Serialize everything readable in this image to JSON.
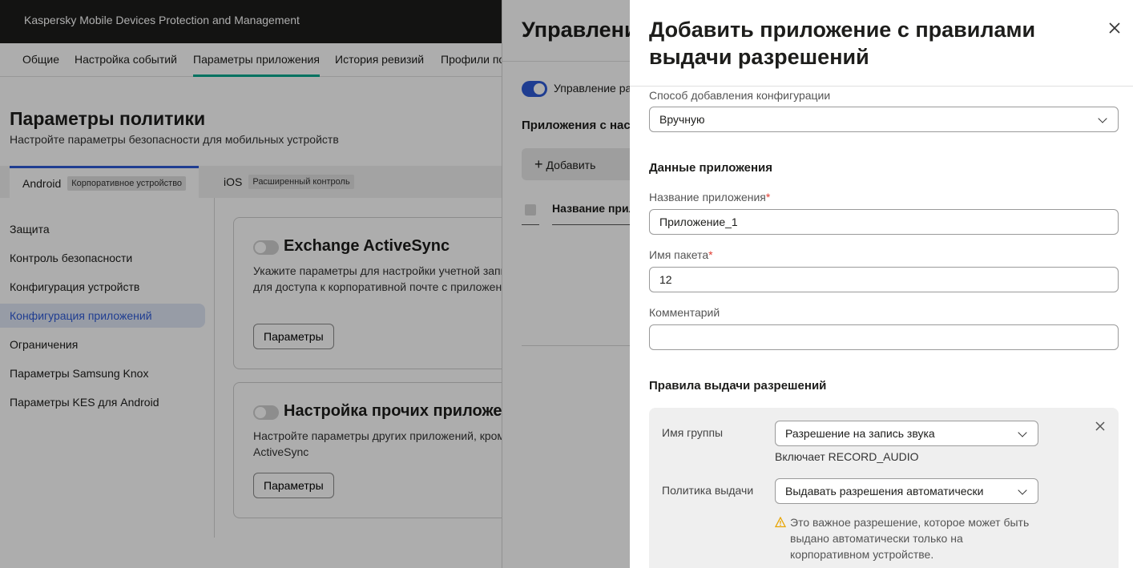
{
  "app": {
    "brand": "Kaspersky Mobile Devices Protection and Management"
  },
  "subnav": {
    "tabs": [
      "Общие",
      "Настройка событий",
      "Параметры приложения",
      "История ревизий",
      "Профили по"
    ]
  },
  "page": {
    "title": "Параметры политики",
    "subtitle": "Настройте параметры безопасности для мобильных устройств"
  },
  "os_tabs": [
    {
      "label": "Android",
      "badge": "Корпоративное устройство"
    },
    {
      "label": "iOS",
      "badge": "Расширенный контроль"
    }
  ],
  "sidebar": {
    "items": [
      "Защита",
      "Контроль безопасности",
      "Конфигурация устройств",
      "Конфигурация приложений",
      "Ограничения",
      "Параметры Samsung Knox",
      "Параметры KES для Android"
    ]
  },
  "cards": [
    {
      "title": "Exchange ActiveSync",
      "desc": "Укажите параметры для настройки учетной запи ActiveSync для доступа к корпоративной почте с приложения Gmail",
      "button": "Параметры"
    },
    {
      "title": "Настройка прочих приложен",
      "desc": "Настройте параметры других приложений, кром Exchange ActiveSync",
      "button": "Параметры"
    }
  ],
  "drawer2": {
    "title": "Управлени",
    "toggle_label": "Управление ра",
    "section": "Приложения с нас",
    "add_button": "Добавить",
    "col_header": "Название прил"
  },
  "drawer": {
    "title": "Добавить приложение с правилами выдачи разрешений",
    "config_method": {
      "label": "Способ добавления конфигурации",
      "value": "Вручную"
    },
    "app_data_heading": "Данные приложения",
    "app_name": {
      "label": "Название приложения",
      "value": "Приложение_1"
    },
    "package": {
      "label": "Имя пакета",
      "value": "12"
    },
    "comment": {
      "label": "Комментарий",
      "value": ""
    },
    "rules_heading": "Правила выдачи разрешений",
    "rule": {
      "group_label": "Имя группы",
      "group_value": "Разрешение на запись звука",
      "includes": "Включает RECORD_AUDIO",
      "policy_label": "Политика выдачи",
      "policy_value": "Выдавать разрешения автоматически",
      "warning": "Это важное разрешение, которое может быть выдано автоматически только на корпоративном устройстве."
    }
  },
  "colors": {
    "accent": "#2e5bd6",
    "active_tab_underline": "#00a88e",
    "topbar": "#1d1d1b",
    "warning": "#e8a400",
    "required": "#e03c31"
  }
}
